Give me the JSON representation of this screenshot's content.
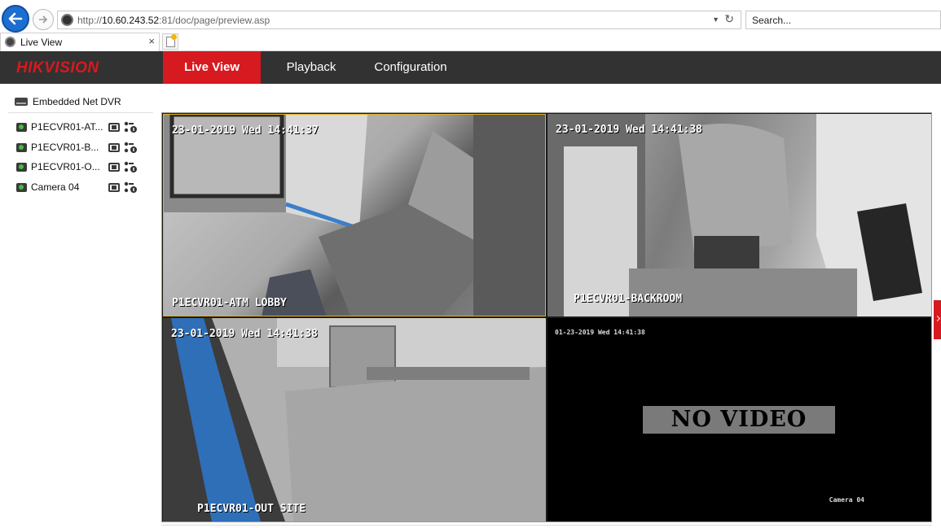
{
  "browser": {
    "url_prefix": "http://",
    "url_host": "10.60.243.52",
    "url_rest": ":81/doc/page/preview.asp",
    "search_placeholder": "Search...",
    "tab_title": "Live View",
    "tab_close": "×"
  },
  "app": {
    "brand": "HIKVISION",
    "nav": {
      "live_view": "Live View",
      "playback": "Playback",
      "configuration": "Configuration"
    },
    "accent_color": "#d71920"
  },
  "sidebar": {
    "device_label": "Embedded Net DVR",
    "cameras": [
      {
        "label": "P1ECVR01-AT..."
      },
      {
        "label": "P1ECVR01-B..."
      },
      {
        "label": "P1ECVR01-O..."
      },
      {
        "label": "Camera 04"
      }
    ]
  },
  "tiles": [
    {
      "timestamp": "23-01-2019 Wed 14:41:37",
      "name": "P1ECVR01-ATM LOBBY",
      "selected": true
    },
    {
      "timestamp": "23-01-2019 Wed 14:41:38",
      "name": "P1ECVR01-BACKROOM"
    },
    {
      "timestamp": "23-01-2019 Wed 14:41:38",
      "name": "P1ECVR01-OUT SITE"
    },
    {
      "timestamp": "01-23-2019 Wed 14:41:38",
      "name": "Camera 04",
      "status": "NO VIDEO"
    }
  ]
}
